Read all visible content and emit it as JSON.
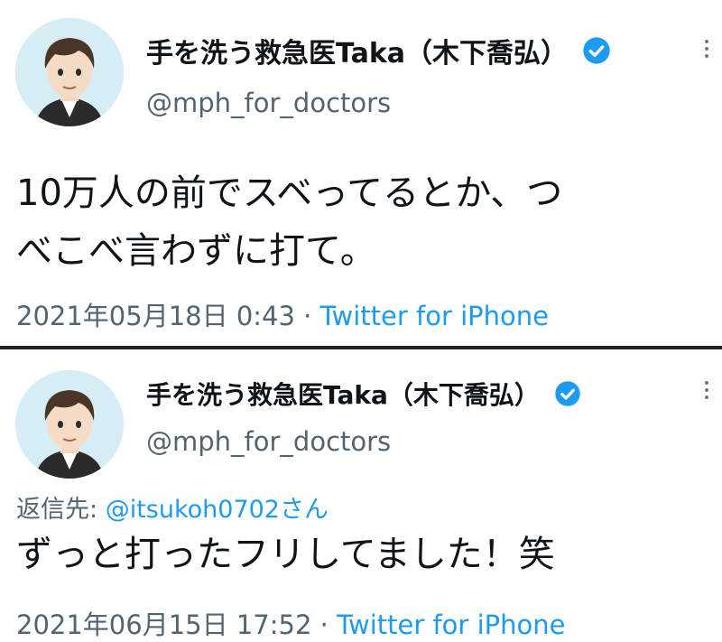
{
  "colors": {
    "link": "#1d9bf0",
    "secondary_text": "#536471",
    "primary_text": "#0f1419"
  },
  "tweets": [
    {
      "author_name": "手を洗う救急医Taka（木下喬弘）",
      "handle": "@mph_for_doctors",
      "verified_icon": "verified-badge-icon",
      "text_lines": [
        "10万人の前でスベってるとか、つ",
        "べこべ言わずに打て。"
      ],
      "date": "2021年05月18日 0:43",
      "separator": "·",
      "source": "Twitter for iPhone"
    },
    {
      "author_name": "手を洗う救急医Taka（木下喬弘）",
      "handle": "@mph_for_doctors",
      "verified_icon": "verified-badge-icon",
      "reply_label": "返信先:",
      "reply_to": "@itsukoh0702さん",
      "text_lines": [
        "ずっと打ったフリしてました！笑"
      ],
      "date": "2021年06月15日 17:52",
      "separator": "·",
      "source": "Twitter for iPhone"
    }
  ]
}
